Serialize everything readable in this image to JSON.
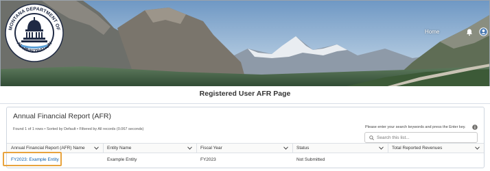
{
  "banner": {
    "logo_text_top": "MONTANA DEPARTMENT OF",
    "logo_text_bottom": "ADMINISTRATION",
    "logo_icon": "capitol-dome-seal",
    "nav": {
      "home_label": "Home",
      "bell_icon": "bell-icon",
      "user_icon": "user-avatar-icon"
    }
  },
  "page": {
    "title": "Registered User AFR Page"
  },
  "card": {
    "title": "Annual Financial Report (AFR)",
    "meta": "Found 1 of 1 rows • Sorted by Default • Filtered by All records (0.067 seconds)",
    "search_hint": "Please enter your search keywords and press the Enter key.",
    "search_placeholder": "Search this list...",
    "columns": [
      "Annual Financial Report (AFR) Name",
      "Entity Name",
      "Fiscal Year",
      "Status",
      "Total Reported Revenues"
    ],
    "rows": [
      {
        "afr_name": "FY2023: Example Entity",
        "entity_name": "Example Entity",
        "fiscal_year": "FY2023",
        "status": "Not Submitted",
        "total_revenues": ""
      }
    ]
  },
  "colors": {
    "link": "#0b5cab",
    "highlight": "#e8a33d",
    "sky": "#8fb3d3",
    "mountain": "#7d8d80"
  }
}
